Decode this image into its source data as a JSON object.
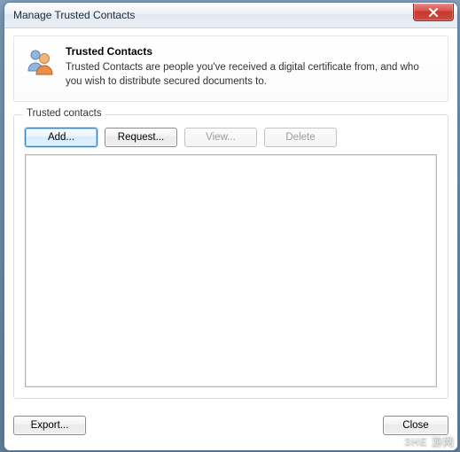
{
  "window": {
    "title": "Manage Trusted Contacts"
  },
  "header": {
    "heading": "Trusted Contacts",
    "description": "Trusted Contacts are people you've received a digital certificate from, and who you wish to distribute secured documents to."
  },
  "group": {
    "legend": "Trusted contacts",
    "buttons": {
      "add": "Add...",
      "request": "Request...",
      "view": "View...",
      "delete": "Delete"
    },
    "items": []
  },
  "footer": {
    "export": "Export...",
    "close": "Close"
  },
  "watermark": "3HE 游网"
}
